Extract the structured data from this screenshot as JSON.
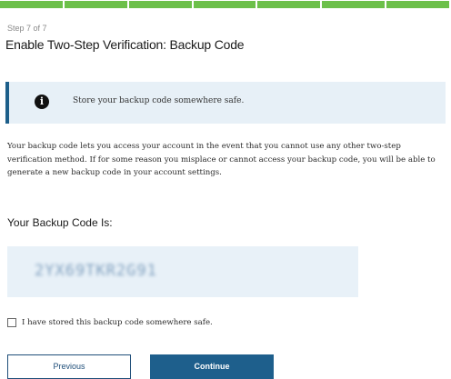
{
  "progress": {
    "total_steps": 7,
    "completed_steps": 7,
    "color": "#6cc04a"
  },
  "step_label": "Step 7 of 7",
  "page_title": "Enable Two-Step Verification: Backup Code",
  "alert": {
    "icon": "info-icon",
    "icon_glyph": "i",
    "text": "Store your backup code somewhere safe.",
    "accent_color": "#1d5f8a",
    "background_color": "#e7f0f7"
  },
  "description": "Your backup code lets you access your account in the event that you cannot use any other two-step verification method. If for some reason you misplace or cannot access your backup code, you will be able to generate a new backup code in your account settings.",
  "backup_code": {
    "heading": "Your Backup Code Is:",
    "value": "2YX69TKR2G91"
  },
  "confirm": {
    "label": "I have stored this backup code somewhere safe.",
    "checked": false
  },
  "buttons": {
    "previous_label": "Previous",
    "continue_label": "Continue",
    "primary_color": "#1e5f8c"
  }
}
